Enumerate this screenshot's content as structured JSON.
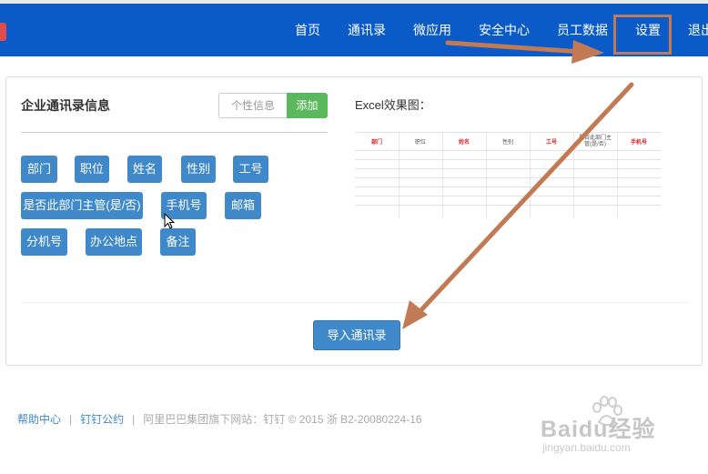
{
  "nav": {
    "items": [
      {
        "label": "首页"
      },
      {
        "label": "通讯录"
      },
      {
        "label": "微应用"
      },
      {
        "label": "安全中心"
      },
      {
        "label": "员工数据"
      },
      {
        "label": "设置"
      },
      {
        "label": "退出"
      }
    ],
    "bar_color": "#0a5ac8"
  },
  "form": {
    "title": "企业通讯录信息",
    "custom_placeholder": "个性信息",
    "add_label": "添加",
    "fields": [
      "部门",
      "职位",
      "姓名",
      "性别",
      "工号",
      "是否此部门主管(是/否)",
      "手机号",
      "邮箱",
      "分机号",
      "办公地点",
      "备注"
    ],
    "tag_color": "#3f88c9"
  },
  "excel": {
    "title": "Excel效果图：",
    "headers": [
      {
        "label": "部门",
        "highlight": true
      },
      {
        "label": "职位",
        "highlight": false
      },
      {
        "label": "姓名",
        "highlight": true
      },
      {
        "label": "性别",
        "highlight": false
      },
      {
        "label": "工号",
        "highlight": true
      },
      {
        "label": "是否此部门主管(是/否)",
        "highlight": false
      },
      {
        "label": "手机号",
        "highlight": true
      }
    ]
  },
  "import_label": "导入通讯录",
  "footer": {
    "help": "帮助中心",
    "sep": "|",
    "pact": "钉钉公约",
    "copyright": "阿里巴巴集团旗下网站：钉钉 © 2015 浙 B2-20080224-16"
  },
  "watermark": {
    "text": "Baidu经验",
    "url": "jingyan.baidu.com"
  },
  "colors": {
    "annotation": "#c27a55",
    "add_button": "#5cb85c"
  }
}
